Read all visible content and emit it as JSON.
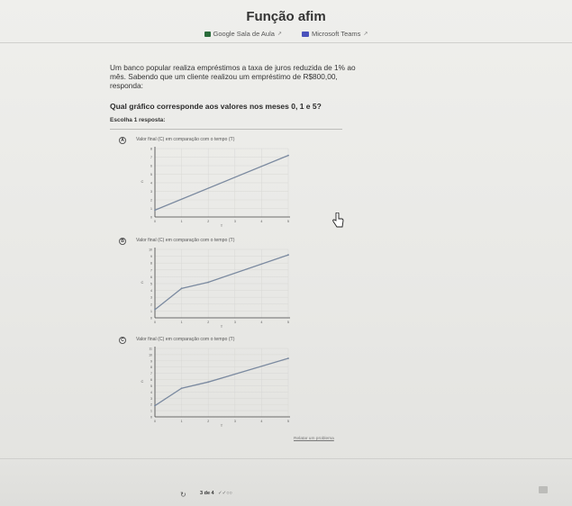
{
  "header": {
    "title": "Função afim",
    "links": [
      {
        "label": "Google Sala de Aula",
        "icon": "google-classroom-icon"
      },
      {
        "label": "Microsoft Teams",
        "icon": "microsoft-teams-icon"
      }
    ],
    "external_icon": "↗"
  },
  "question": {
    "statement": "Um banco popular realiza empréstimos a taxa de juros reduzida de 1% ao mês. Sabendo que um cliente realizou um empréstimo de R$800,00, responda:",
    "prompt": "Qual gráfico corresponde aos valores nos meses 0, 1 e 5?",
    "choose_label": "Escolha 1 resposta:"
  },
  "options": [
    {
      "letter": "A",
      "caption": "Valor final (C) em comparação com o tempo (T)"
    },
    {
      "letter": "B",
      "caption": "Valor final (C) em comparação com o tempo (T)"
    },
    {
      "letter": "C",
      "caption": "Valor final (C) em comparação com o tempo (T)"
    }
  ],
  "chart_data": [
    {
      "type": "line",
      "title": "Valor final (C) em comparação com o tempo (T)",
      "xlabel": "T",
      "ylabel": "C",
      "x": [
        0,
        5
      ],
      "series": [
        {
          "values": [
            0.8,
            7.2
          ]
        }
      ],
      "xlim": [
        0,
        5
      ],
      "ylim": [
        0,
        8
      ],
      "grid": true
    },
    {
      "type": "line",
      "title": "Valor final (C) em comparação com o tempo (T)",
      "xlabel": "T",
      "ylabel": "C",
      "x": [
        0,
        1,
        2,
        5
      ],
      "series": [
        {
          "values": [
            1.2,
            4.3,
            5.2,
            9.2
          ]
        }
      ],
      "xlim": [
        0,
        5
      ],
      "ylim": [
        0,
        10
      ],
      "grid": true
    },
    {
      "type": "line",
      "title": "Valor final (C) em comparação com o tempo (T)",
      "xlabel": "T",
      "ylabel": "C",
      "x": [
        0,
        1,
        2,
        5
      ],
      "series": [
        {
          "values": [
            1.8,
            4.6,
            5.6,
            9.4
          ]
        }
      ],
      "xlim": [
        0,
        5
      ],
      "ylim": [
        0,
        11
      ],
      "grid": true
    }
  ],
  "footer": {
    "report_label": "Relatar um problema",
    "progress": "3 de 4",
    "status_marks": "✓✓○○",
    "refresh_icon": "↻"
  },
  "colors": {
    "line": "#7b8aa0",
    "grid": "#d8d8d5",
    "axis": "#444444"
  }
}
